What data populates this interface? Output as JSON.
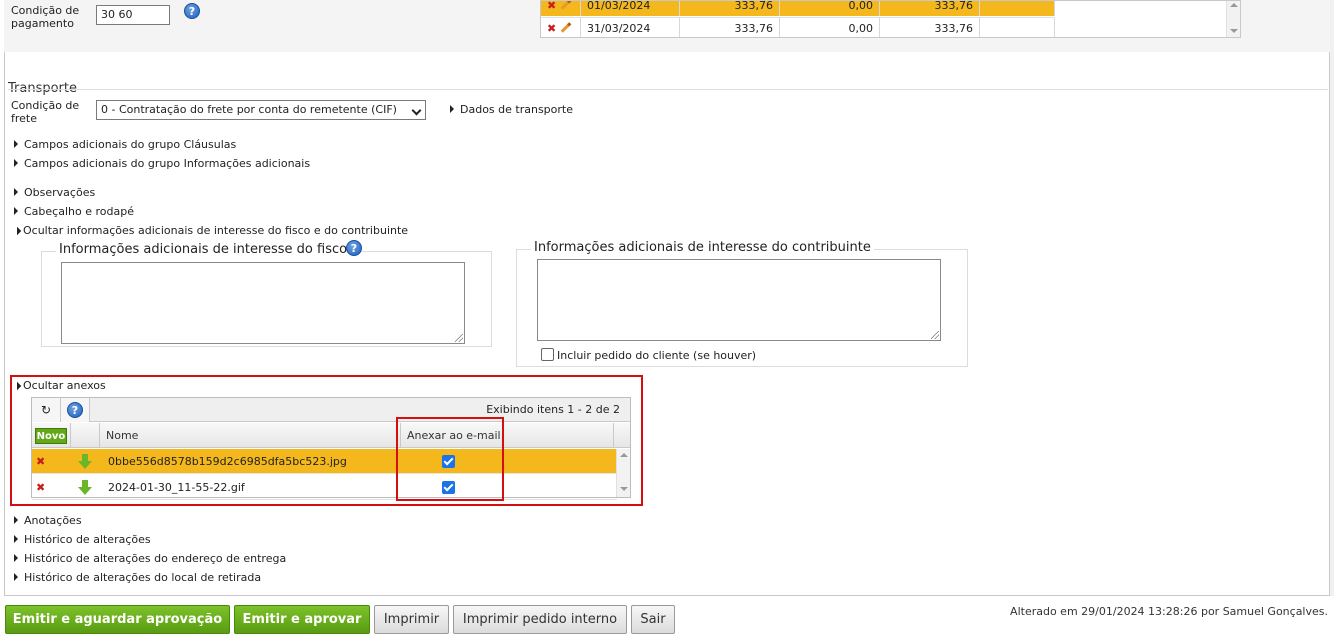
{
  "payment": {
    "label_line1": "Condição de",
    "label_line2": "pagamento",
    "value": "30 60",
    "help": "?",
    "rows": [
      {
        "date": "01/03/2024",
        "v1": "333,76",
        "v2": "0,00",
        "v3": "333,76",
        "highlight": true
      },
      {
        "date": "31/03/2024",
        "v1": "333,76",
        "v2": "0,00",
        "v3": "333,76",
        "highlight": false
      }
    ]
  },
  "transport": {
    "title": "Transporte",
    "label_line1": "Condição de",
    "label_line2": "frete",
    "select_value": "0 - Contratação do frete por conta do remetente (CIF)",
    "link_dados": "Dados de transporte"
  },
  "links": {
    "clausulas": "Campos adicionais do grupo Cláusulas",
    "info_adicionais": "Campos adicionais do grupo Informações adicionais",
    "observacoes": "Observações",
    "cabecalho": "Cabeçalho e rodapé",
    "ocultar_info": "Ocultar informações adicionais de interesse do fisco e do contribuinte"
  },
  "fisco": {
    "legend": "Informações adicionais de interesse do fisco",
    "help": "?"
  },
  "contribuinte": {
    "legend": "Informações adicionais de interesse do contribuinte",
    "checkbox_label": "Incluir pedido do cliente (se houver)"
  },
  "anexos": {
    "toggle": "Ocultar anexos",
    "refresh_icon": "↻",
    "help": "?",
    "paging": "Exibindo itens 1 - 2 de 2",
    "novo": "Novo",
    "col_nome": "Nome",
    "col_anexar": "Anexar ao e-mail",
    "files": [
      {
        "name": "0bbe556d8578b159d2c6985dfa5bc523.jpg",
        "attach": true,
        "highlight": true
      },
      {
        "name": "2024-01-30_11-55-22.gif",
        "attach": true,
        "highlight": false
      }
    ]
  },
  "more_links": {
    "anotacoes": "Anotações",
    "historico": "Histórico de alterações",
    "historico_endereco": "Histórico de alterações do endereço de entrega",
    "historico_local": "Histórico de alterações do local de retirada"
  },
  "buttons": {
    "emitir_aguardar": "Emitir e aguardar aprovação",
    "emitir_aprovar": "Emitir e aprovar",
    "imprimir": "Imprimir",
    "imprimir_interno": "Imprimir pedido interno",
    "sair": "Sair"
  },
  "footer": {
    "altered": "Alterado em 29/01/2024 13:28:26 por Samuel Gonçalves."
  },
  "colors": {
    "highlight": "#f5b81c",
    "green": "#63a816",
    "red_box": "#d40f0f"
  }
}
